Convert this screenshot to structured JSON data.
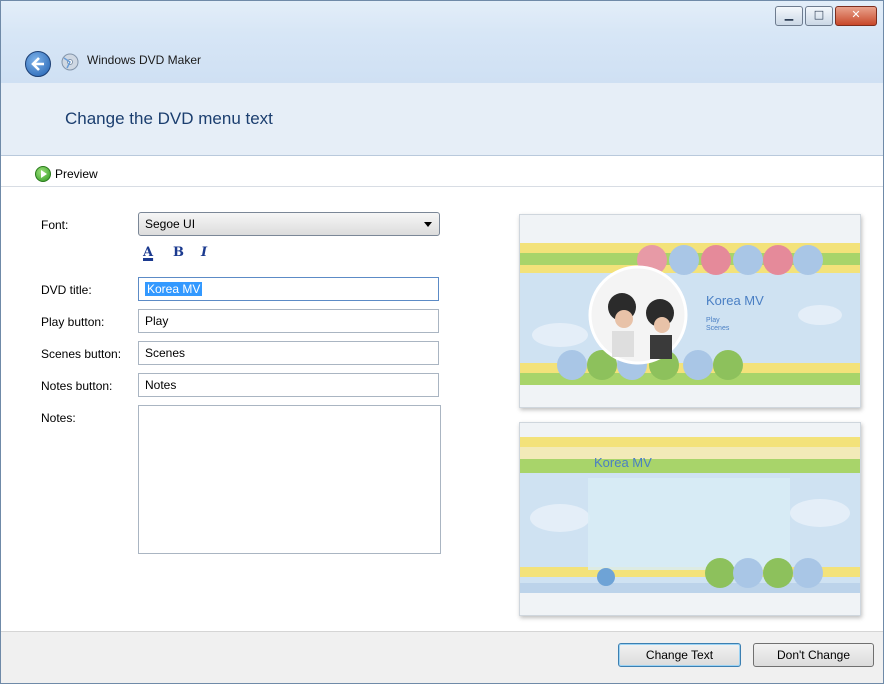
{
  "window": {
    "title": "Windows DVD Maker",
    "controls": {
      "minimize": "▁",
      "maximize": "□",
      "close": "✕"
    }
  },
  "header": {
    "heading": "Change the DVD menu text"
  },
  "toolbar": {
    "preview_label": "Preview"
  },
  "form": {
    "font": {
      "label": "Font:",
      "value": "Segoe UI"
    },
    "format_buttons": {
      "color": "A",
      "bold": "B",
      "italic": "I"
    },
    "dvd_title": {
      "label": "DVD title:",
      "value": "Korea MV"
    },
    "play_button": {
      "label": "Play button:",
      "value": "Play"
    },
    "scenes_button": {
      "label": "Scenes button:",
      "value": "Scenes"
    },
    "notes_button": {
      "label": "Notes button:",
      "value": "Notes"
    },
    "notes": {
      "label": "Notes:",
      "value": ""
    }
  },
  "previews": {
    "main_menu": {
      "title": "Korea MV",
      "items": [
        "Play",
        "Scenes"
      ]
    },
    "scenes_menu": {
      "title": "Korea MV"
    }
  },
  "footer": {
    "change_text": "Change Text",
    "dont_change": "Don't Change"
  },
  "colors": {
    "heading": "#1b3e6f",
    "accent_blue": "#3399ff",
    "green_stripe": "#a8d46a",
    "yellow_stripe": "#f3e27a"
  }
}
